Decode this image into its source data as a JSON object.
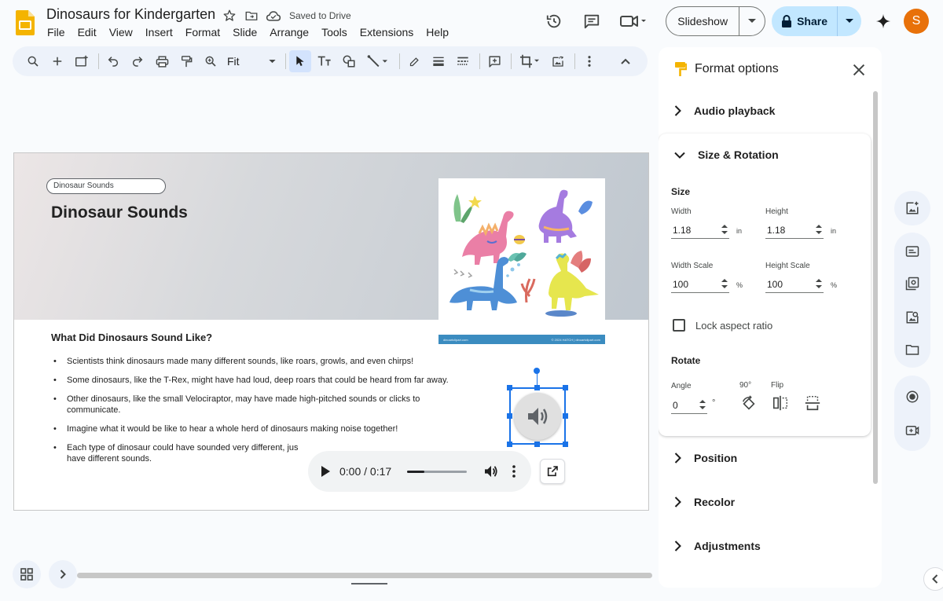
{
  "app": {
    "doc_title": "Dinosaurs for Kindergarten",
    "saved_status": "Saved to Drive",
    "menu": [
      "File",
      "Edit",
      "View",
      "Insert",
      "Format",
      "Slide",
      "Arrange",
      "Tools",
      "Extensions",
      "Help"
    ],
    "slideshow_label": "Slideshow",
    "share_label": "Share",
    "avatar_initial": "S",
    "zoom_label": "Fit"
  },
  "colors": {
    "accent": "#1a73e8",
    "share_bg": "#c2e7ff",
    "toolbar_bg": "#edf2fa",
    "avatar": "#e8710a",
    "logo": "#f4b400"
  },
  "slide": {
    "tag": "Dinosaur Sounds",
    "title": "Dinosaur Sounds",
    "subtitle": "What Did Dinosaurs Sound Like?",
    "bullets": [
      "Scientists think dinosaurs made many different sounds, like roars, growls, and even chirps!",
      "Some dinosaurs, like the T-Rex, might have had loud, deep roars that could be heard from far away.",
      "Other dinosaurs, like the small Velociraptor, may have made high-pitched sounds or clicks to communicate.",
      "Imagine what it would be like to hear a whole herd of dinosaurs making noise together!",
      "Each type of dinosaur could have sounded very different, jus"
    ],
    "bullet5_tail": "have different sounds.",
    "art_footer_left": "dinoartclipart.com",
    "art_footer_right": "© 2024 HATCH | dinoartclipart.com"
  },
  "audio": {
    "time": "0:00 / 0:17",
    "progress": 0.29
  },
  "panel": {
    "title": "Format options",
    "sections": {
      "audio_playback": "Audio playback",
      "size_rotation": "Size & Rotation",
      "position": "Position",
      "recolor": "Recolor",
      "adjustments": "Adjustments"
    },
    "size_heading": "Size",
    "width_label": "Width",
    "width_value": "1.18",
    "height_label": "Height",
    "height_value": "1.18",
    "unit_in": "in",
    "width_scale_label": "Width Scale",
    "width_scale_value": "100",
    "height_scale_label": "Height Scale",
    "height_scale_value": "100",
    "unit_pct": "%",
    "lock_label": "Lock aspect ratio",
    "rotate_heading": "Rotate",
    "angle_label": "Angle",
    "angle_value": "0",
    "degree": "°",
    "ninety_label": "90°",
    "flip_label": "Flip"
  }
}
